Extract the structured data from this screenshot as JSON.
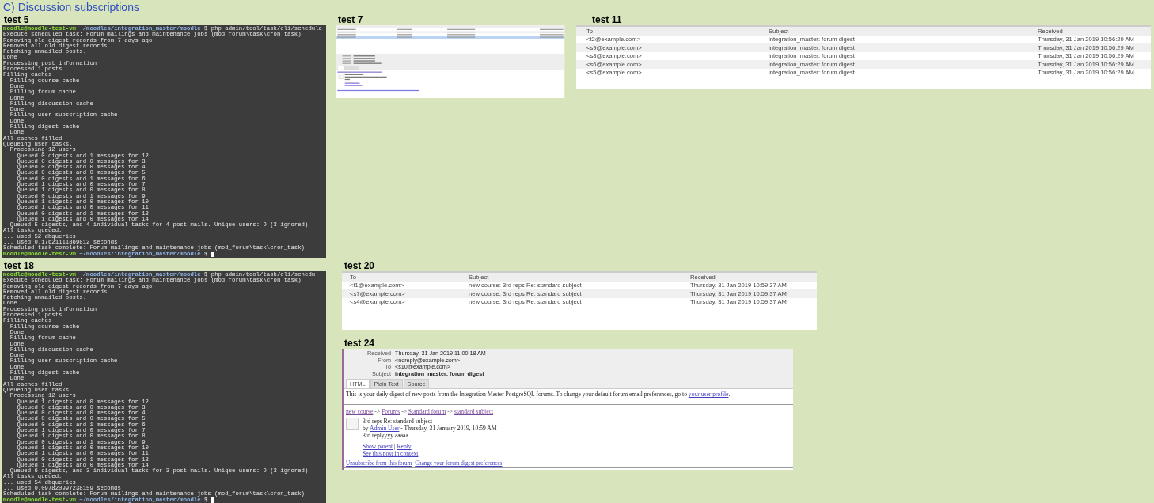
{
  "title": "C) Discussion subscriptions",
  "panels": [
    {
      "label": "test 5",
      "kind": "terminal",
      "lines": [
        {
          "kind": "prompt",
          "user": "moodle@moodle-test-vm",
          "path": "~/moodles/integration_master/moodle",
          "command": "$ php admin/tool/task/cli/schedule",
          "cursor": false
        },
        {
          "kind": "output",
          "text": "Execute scheduled task: Forum mailings and maintenance jobs (mod_forum\\task\\cron_task)"
        },
        {
          "kind": "output",
          "text": "Removing old digest records from 7 days ago."
        },
        {
          "kind": "output",
          "text": "Removed all old digest records."
        },
        {
          "kind": "output",
          "text": "Fetching unmailed posts."
        },
        {
          "kind": "output",
          "text": "Done"
        },
        {
          "kind": "output",
          "text": "Processing post information"
        },
        {
          "kind": "output",
          "text": "Processed 1 posts"
        },
        {
          "kind": "output",
          "text": "Filling caches"
        },
        {
          "kind": "output",
          "text": "  Filling course cache"
        },
        {
          "kind": "output",
          "text": "  Done"
        },
        {
          "kind": "output",
          "text": "  Filling forum cache"
        },
        {
          "kind": "output",
          "text": "  Done"
        },
        {
          "kind": "output",
          "text": "  Filling discussion cache"
        },
        {
          "kind": "output",
          "text": "  Done"
        },
        {
          "kind": "output",
          "text": "  Filling user subscription cache"
        },
        {
          "kind": "output",
          "text": "  Done"
        },
        {
          "kind": "output",
          "text": "  Filling digest cache"
        },
        {
          "kind": "output",
          "text": "  Done"
        },
        {
          "kind": "output",
          "text": "All caches filled"
        },
        {
          "kind": "output",
          "text": "Queueing user tasks."
        },
        {
          "kind": "output",
          "text": "  Processing 12 users"
        },
        {
          "kind": "output",
          "text": "    Queued 0 digests and 1 messages for 12"
        },
        {
          "kind": "output",
          "text": "    Queued 0 digests and 0 messages for 3"
        },
        {
          "kind": "output",
          "text": "    Queued 0 digests and 0 messages for 4"
        },
        {
          "kind": "output",
          "text": "    Queued 0 digests and 0 messages for 5"
        },
        {
          "kind": "output",
          "text": "    Queued 0 digests and 1 messages for 6"
        },
        {
          "kind": "output",
          "text": "    Queued 1 digests and 0 messages for 7"
        },
        {
          "kind": "output",
          "text": "    Queued 1 digests and 0 messages for 8"
        },
        {
          "kind": "output",
          "text": "    Queued 0 digests and 1 messages for 9"
        },
        {
          "kind": "output",
          "text": "    Queued 1 digests and 0 messages for 10"
        },
        {
          "kind": "output",
          "text": "    Queued 1 digests and 0 messages for 11"
        },
        {
          "kind": "output",
          "text": "    Queued 0 digests and 1 messages for 13"
        },
        {
          "kind": "output",
          "text": "    Queued 1 digests and 0 messages for 14"
        },
        {
          "kind": "output",
          "text": "  Queued 5 digests, and 4 individual tasks for 4 post mails. Unique users: 9 (3 ignored)"
        },
        {
          "kind": "output",
          "text": "All tasks queued."
        },
        {
          "kind": "output",
          "text": "... used 52 dbqueries"
        },
        {
          "kind": "output",
          "text": "... used 0.17621111869812 seconds"
        },
        {
          "kind": "output",
          "text": "Scheduled task complete: Forum mailings and maintenance jobs (mod_forum\\task\\cron_task)"
        },
        {
          "kind": "prompt",
          "user": "moodle@moodle-test-vm",
          "path": "~/moodles/integration_master/moodle",
          "command": "$",
          "cursor": true
        }
      ]
    },
    {
      "label": "test 7",
      "kind": "preview"
    },
    {
      "label": "test 11",
      "kind": "list",
      "columns": [
        "To",
        "Subject",
        "Received"
      ],
      "rows": [
        [
          "<t2@example.com>",
          "integration_master: forum digest",
          "Thursday, 31 Jan 2019 10:56:29 AM"
        ],
        [
          "<s9@example.com>",
          "integration_master: forum digest",
          "Thursday, 31 Jan 2019 10:56:29 AM"
        ],
        [
          "<s8@example.com>",
          "integration_master: forum digest",
          "Thursday, 31 Jan 2019 10:56:29 AM"
        ],
        [
          "<s6@example.com>",
          "integration_master: forum digest",
          "Thursday, 31 Jan 2019 10:56:29 AM"
        ],
        [
          "<s5@example.com>",
          "integration_master: forum digest",
          "Thursday, 31 Jan 2019 10:56:29 AM"
        ]
      ]
    },
    {
      "label": "test 18",
      "kind": "terminal",
      "lines": [
        {
          "kind": "prompt",
          "user": "moodle@moodle-test-vm",
          "path": "~/moodles/integration_master/moodle",
          "command": "$ php admin/tool/task/cli/schedu",
          "cursor": false
        },
        {
          "kind": "output",
          "text": "Execute scheduled task: Forum mailings and maintenance jobs (mod_forum\\task\\cron_task)"
        },
        {
          "kind": "output",
          "text": "Removing old digest records from 7 days ago."
        },
        {
          "kind": "output",
          "text": "Removed all old digest records."
        },
        {
          "kind": "output",
          "text": "Fetching unmailed posts."
        },
        {
          "kind": "output",
          "text": "Done"
        },
        {
          "kind": "output",
          "text": "Processing post information"
        },
        {
          "kind": "output",
          "text": "Processed 1 posts"
        },
        {
          "kind": "output",
          "text": "Filling caches"
        },
        {
          "kind": "output",
          "text": "  Filling course cache"
        },
        {
          "kind": "output",
          "text": "  Done"
        },
        {
          "kind": "output",
          "text": "  Filling forum cache"
        },
        {
          "kind": "output",
          "text": "  Done"
        },
        {
          "kind": "output",
          "text": "  Filling discussion cache"
        },
        {
          "kind": "output",
          "text": "  Done"
        },
        {
          "kind": "output",
          "text": "  Filling user subscription cache"
        },
        {
          "kind": "output",
          "text": "  Done"
        },
        {
          "kind": "output",
          "text": "  Filling digest cache"
        },
        {
          "kind": "output",
          "text": "  Done"
        },
        {
          "kind": "output",
          "text": "All caches filled"
        },
        {
          "kind": "output",
          "text": "Queueing user tasks."
        },
        {
          "kind": "output",
          "text": "  Processing 12 users"
        },
        {
          "kind": "output",
          "text": "    Queued 1 digests and 0 messages for 12"
        },
        {
          "kind": "output",
          "text": "    Queued 0 digests and 0 messages for 3"
        },
        {
          "kind": "output",
          "text": "    Queued 0 digests and 0 messages for 4"
        },
        {
          "kind": "output",
          "text": "    Queued 0 digests and 0 messages for 5"
        },
        {
          "kind": "output",
          "text": "    Queued 0 digests and 1 messages for 6"
        },
        {
          "kind": "output",
          "text": "    Queued 1 digests and 0 messages for 7"
        },
        {
          "kind": "output",
          "text": "    Queued 1 digests and 0 messages for 8"
        },
        {
          "kind": "output",
          "text": "    Queued 0 digests and 1 messages for 9"
        },
        {
          "kind": "output",
          "text": "    Queued 1 digests and 0 messages for 10"
        },
        {
          "kind": "output",
          "text": "    Queued 1 digests and 0 messages for 11"
        },
        {
          "kind": "output",
          "text": "    Queued 0 digests and 1 messages for 13"
        },
        {
          "kind": "output",
          "text": "    Queued 1 digests and 0 messages for 14"
        },
        {
          "kind": "output",
          "text": "  Queued 6 digests, and 3 individual tasks for 3 post mails. Unique users: 9 (3 ignored)"
        },
        {
          "kind": "output",
          "text": "All tasks queued."
        },
        {
          "kind": "output",
          "text": "... used 54 dbqueries"
        },
        {
          "kind": "output",
          "text": "... used 0.097820997238159 seconds"
        },
        {
          "kind": "output",
          "text": "Scheduled task complete: Forum mailings and maintenance jobs (mod_forum\\task\\cron_task)"
        },
        {
          "kind": "prompt",
          "user": "moodle@moodle-test-vm",
          "path": "~/moodles/integration_master/moodle",
          "command": "$",
          "cursor": true
        }
      ]
    },
    {
      "label": "test 20",
      "kind": "list",
      "columns": [
        "To",
        "Subject",
        "Received"
      ],
      "rows": [
        [
          "<t1@example.com>",
          "new course: 3rd reps Re: standard subject",
          "Thursday, 31 Jan 2019 10:59:37 AM"
        ],
        [
          "<s7@example.com>",
          "new course: 3rd reps Re: standard subject",
          "Thursday, 31 Jan 2019 10:59:37 AM"
        ],
        [
          "<s4@example.com>",
          "new course: 3rd reps Re: standard subject",
          "Thursday, 31 Jan 2019 10:59:37 AM"
        ]
      ]
    },
    {
      "label": "test 24",
      "kind": "message",
      "headers": [
        {
          "label": "Received",
          "value": "Thursday, 31 Jan 2019 11:00:18 AM"
        },
        {
          "label": "From",
          "value": "<noreply@example.com>"
        },
        {
          "label": "To",
          "value": "<s10@example.com>"
        },
        {
          "label": "Subject",
          "value": "integration_master: forum digest"
        }
      ],
      "tabs": [
        {
          "label": "HTML",
          "selected": true
        },
        {
          "label": "Plain Text",
          "selected": false
        },
        {
          "label": "Source",
          "selected": false
        }
      ],
      "intro": "This is your daily digest of new posts from the Integration Master PostgreSQL forums. To change your default forum email preferences, go to",
      "intro_link": "your user profile",
      "intro_end": ".",
      "breadcrumb": [
        {
          "kind": "link",
          "text": "new course"
        },
        {
          "kind": "separator",
          "text": "->"
        },
        {
          "kind": "link",
          "text": "Forums"
        },
        {
          "kind": "separator",
          "text": "->"
        },
        {
          "kind": "link",
          "text": "Standard forum"
        },
        {
          "kind": "separator",
          "text": "->"
        },
        {
          "kind": "link",
          "text": "standard subject"
        }
      ],
      "post_subject": "3rd reps Re: standard subject",
      "byline_prefix": "by",
      "author": "Admin User",
      "byline_suffix": "- Thursday, 31 January 2019, 10:59 AM",
      "body": "3rd replyyyy aaaaa",
      "actions": [
        {
          "kind": "link",
          "text": "Show parent"
        },
        {
          "kind": "separator",
          "text": "|"
        },
        {
          "kind": "link",
          "text": "Reply"
        }
      ],
      "context_link": "See this post in context",
      "footer_links": [
        "Unsubscribe from this forum",
        "Change your forum digest preferences"
      ]
    }
  ]
}
